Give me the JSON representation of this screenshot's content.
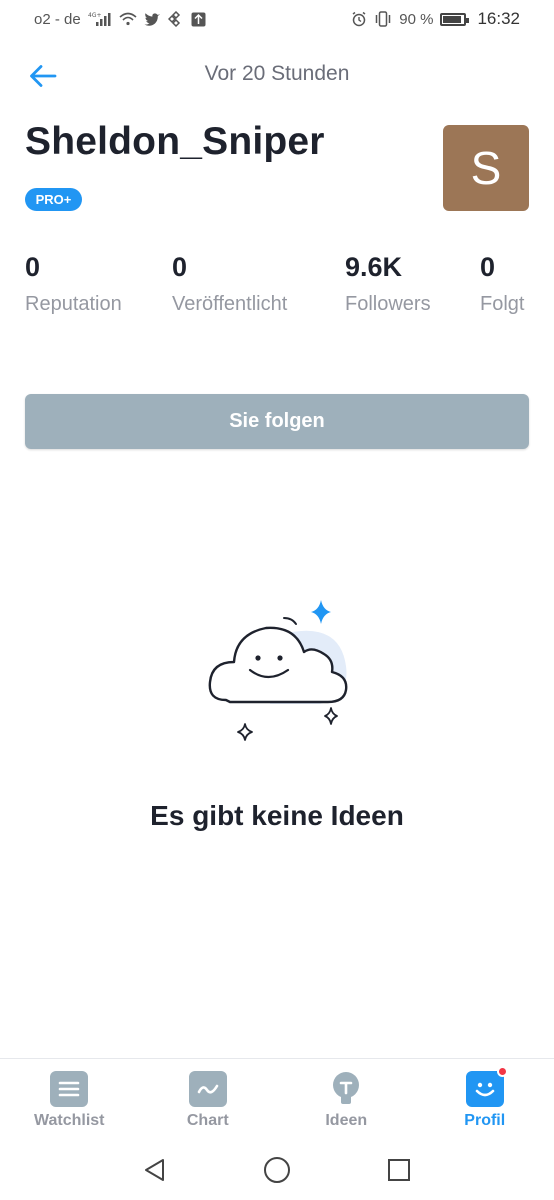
{
  "status_bar": {
    "carrier": "o2 - de",
    "network": "4G+",
    "battery_text": "90 %",
    "time": "16:32"
  },
  "header": {
    "title": "Vor 20 Stunden"
  },
  "profile": {
    "username": "Sheldon_Sniper",
    "badge": "PRO+",
    "avatar_letter": "S"
  },
  "stats": [
    {
      "value": "0",
      "label": "Reputation"
    },
    {
      "value": "0",
      "label": "Veröffentlicht"
    },
    {
      "value": "9.6K",
      "label": "Followers"
    },
    {
      "value": "0",
      "label": "Folgt"
    }
  ],
  "follow_button": {
    "label": "Sie folgen"
  },
  "empty_state": {
    "message": "Es gibt keine Ideen"
  },
  "bottom_nav": {
    "items": [
      {
        "label": "Watchlist",
        "icon": "list-icon"
      },
      {
        "label": "Chart",
        "icon": "chart-icon"
      },
      {
        "label": "Ideen",
        "icon": "lightbulb-icon"
      },
      {
        "label": "Profil",
        "icon": "smiley-icon",
        "active": true
      }
    ]
  },
  "colors": {
    "accent": "#2196f3",
    "follow_button_bg": "#9eb0bb",
    "avatar_bg": "#9c7656",
    "nav_inactive": "#9eb0bb",
    "notification": "#f23645"
  }
}
